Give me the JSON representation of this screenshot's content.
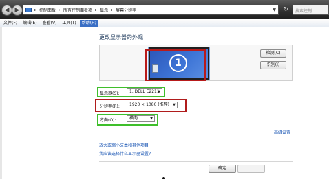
{
  "window": {
    "search_placeholder": "搜索控制"
  },
  "breadcrumb": {
    "items": [
      "控制面板",
      "所有控制面板项",
      "显示",
      "屏幕分辨率"
    ],
    "separator": "▸"
  },
  "menu": {
    "items": [
      "文件(F)",
      "编辑(E)",
      "查看(V)",
      "工具(T)",
      "帮助(H)"
    ],
    "active_index": 4
  },
  "main": {
    "title": "更改显示器的外观",
    "monitor_number": "1",
    "detect_button": "检测(C)",
    "identify_button": "识别(I)"
  },
  "settings": {
    "display_label": "显示器(S):",
    "display_value": "1. DELL E2211H",
    "resolution_label": "分辨率(R):",
    "resolution_value": "1920 × 1080 (推荐)",
    "orientation_label": "方向(O):",
    "orientation_value": "横向"
  },
  "links": {
    "advanced": "高级设置",
    "text_size": "放大或缩小文本和其他项目",
    "which_settings": "我应该选择什么显示器设置?"
  },
  "footer": {
    "ok_button": "确定"
  },
  "colors": {
    "highlight_green": "#3fbf2b",
    "highlight_red": "#b01c1c",
    "link": "#1a56b4",
    "monitor_blue": "#3d74d6"
  }
}
